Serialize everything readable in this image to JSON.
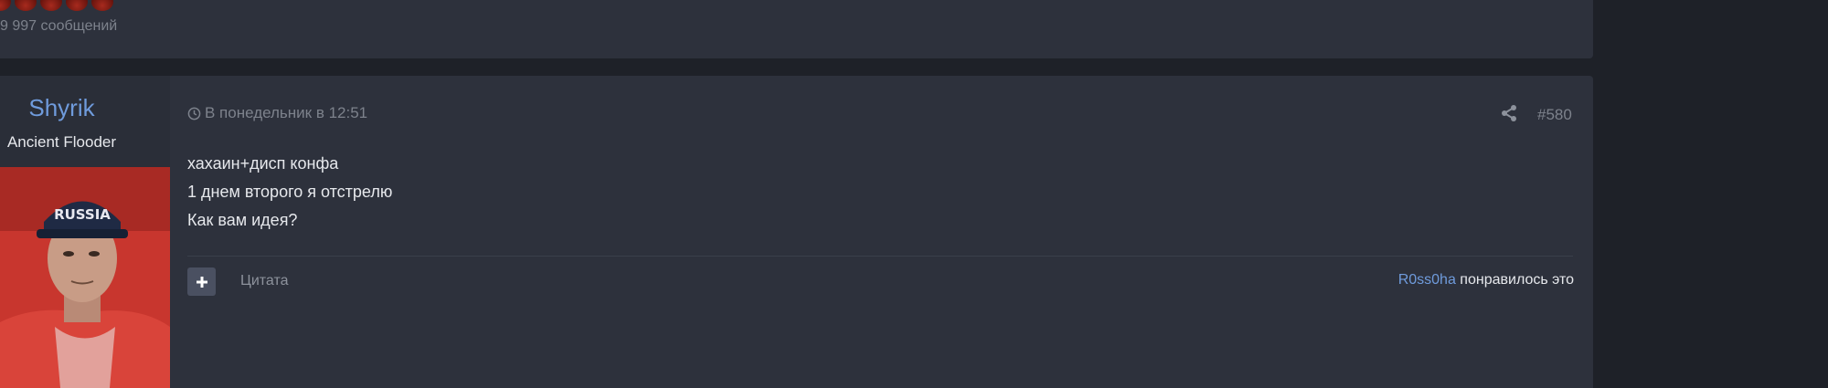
{
  "previous_post": {
    "message_count": "9 997 сообщений"
  },
  "post": {
    "author": {
      "name": "Shyrik",
      "title": "Ancient Flooder"
    },
    "date": "В понедельник в 12:51",
    "number": "#580",
    "body_lines": [
      "хахаин+дисп конфа",
      "1 днем второго я отстрелю",
      "Как вам идея?"
    ],
    "actions": {
      "multiquote_icon": "plus-icon",
      "quote_label": "Цитата"
    },
    "likes": {
      "liker": "R0ss0ha",
      "suffix": " понравилось это"
    }
  },
  "colors": {
    "page_bg": "#1e2128",
    "card_bg": "#2d313c",
    "link": "#6f9bdc",
    "muted": "#7d828c"
  }
}
